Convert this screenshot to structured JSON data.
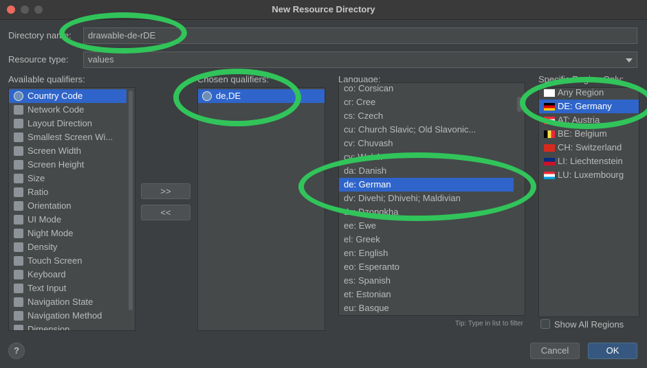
{
  "window": {
    "title": "New Resource Directory"
  },
  "directory_name": {
    "label": "Directory name:",
    "value": "drawable-de-rDE"
  },
  "resource_type": {
    "label": "Resource type:",
    "value": "values"
  },
  "available_qualifiers": {
    "label": "Available qualifiers:",
    "items": [
      {
        "label": "Country Code",
        "icon": "globe-icon",
        "selected": true
      },
      {
        "label": "Network Code",
        "icon": "network-icon"
      },
      {
        "label": "Layout Direction",
        "icon": "layout-direction-icon"
      },
      {
        "label": "Smallest Screen Wi...",
        "icon": "smallest-screen-icon"
      },
      {
        "label": "Screen Width",
        "icon": "screen-width-icon"
      },
      {
        "label": "Screen Height",
        "icon": "screen-height-icon"
      },
      {
        "label": "Size",
        "icon": "size-icon"
      },
      {
        "label": "Ratio",
        "icon": "ratio-icon"
      },
      {
        "label": "Orientation",
        "icon": "orientation-icon"
      },
      {
        "label": "UI Mode",
        "icon": "ui-mode-icon"
      },
      {
        "label": "Night Mode",
        "icon": "night-mode-icon"
      },
      {
        "label": "Density",
        "icon": "density-icon"
      },
      {
        "label": "Touch Screen",
        "icon": "touch-screen-icon"
      },
      {
        "label": "Keyboard",
        "icon": "keyboard-icon"
      },
      {
        "label": "Text Input",
        "icon": "text-input-icon"
      },
      {
        "label": "Navigation State",
        "icon": "navigation-state-icon"
      },
      {
        "label": "Navigation Method",
        "icon": "navigation-method-icon"
      },
      {
        "label": "Dimension",
        "icon": "dimension-icon"
      }
    ]
  },
  "move_buttons": {
    "add": ">>",
    "remove": "<<"
  },
  "chosen_qualifiers": {
    "label": "Chosen qualifiers:",
    "items": [
      {
        "label": "de,DE",
        "icon": "globe-icon",
        "selected": true
      }
    ]
  },
  "language": {
    "label": "Language:",
    "items": [
      {
        "label": "co: Corsican"
      },
      {
        "label": "cr: Cree"
      },
      {
        "label": "cs: Czech"
      },
      {
        "label": "cu: Church Slavic; Old Slavonic..."
      },
      {
        "label": "cv: Chuvash"
      },
      {
        "label": "cy: Welsh"
      },
      {
        "label": "da: Danish"
      },
      {
        "label": "de: German",
        "selected": true
      },
      {
        "label": "dv: Divehi; Dhivehi; Maldivian"
      },
      {
        "label": "dz: Dzongkha"
      },
      {
        "label": "ee: Ewe"
      },
      {
        "label": "el: Greek"
      },
      {
        "label": "en: English"
      },
      {
        "label": "eo: Esperanto"
      },
      {
        "label": "es: Spanish"
      },
      {
        "label": "et: Estonian"
      },
      {
        "label": "eu: Basque"
      }
    ],
    "tip": "Tip: Type in list to filter"
  },
  "region": {
    "label": "Specific Region Only:",
    "items": [
      {
        "label": "Any Region",
        "flag": "blank-flag-icon"
      },
      {
        "label": "DE: Germany",
        "flag": "germany-flag-icon",
        "selected": true
      },
      {
        "label": "AT: Austria",
        "flag": "austria-flag-icon"
      },
      {
        "label": "BE: Belgium",
        "flag": "belgium-flag-icon"
      },
      {
        "label": "CH: Switzerland",
        "flag": "switzerland-flag-icon"
      },
      {
        "label": "LI: Liechtenstein",
        "flag": "liechtenstein-flag-icon"
      },
      {
        "label": "LU: Luxembourg",
        "flag": "luxembourg-flag-icon"
      }
    ],
    "show_all_label": "Show All Regions"
  },
  "buttons": {
    "help": "?",
    "cancel": "Cancel",
    "ok": "OK"
  },
  "colors": {
    "selection": "#2f65ca",
    "highlight": "#31c45a",
    "ok_button": "#365880"
  }
}
